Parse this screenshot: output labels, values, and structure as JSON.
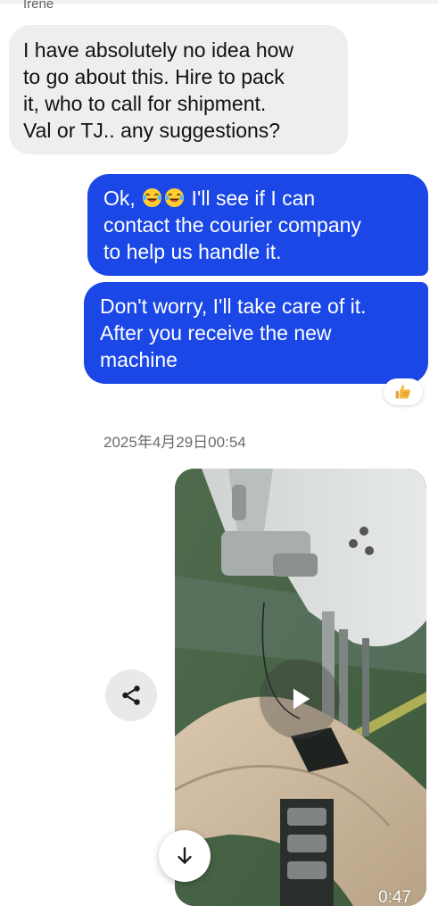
{
  "conversation": {
    "sender_name": "Irene",
    "incoming_message": "I have absolutely no idea how\nto go about this. Hire to pack\nit, who to call for shipment.\nVal or TJ.. any suggestions?",
    "outgoing_message_1_prefix": "Ok, ",
    "outgoing_message_1_suffix": " I'll see if I can\ncontact the courier company\nto help us handle it.",
    "outgoing_message_1_emoji": "laughing-tears-emoji",
    "outgoing_message_2": "Don't worry, I'll take care of it.\nAfter you receive the new\nmachine",
    "reaction": "thumbs-up-emoji",
    "timestamp": "2025年4月29日00:54"
  },
  "video": {
    "duration": "0:47",
    "play_icon": "play-icon"
  },
  "actions": {
    "share_icon": "share-icon",
    "scroll_icon": "arrow-down-icon"
  },
  "colors": {
    "outgoing_bubble": "#1a47e6",
    "incoming_bubble": "#eeeef0",
    "background": "#ffffff"
  }
}
